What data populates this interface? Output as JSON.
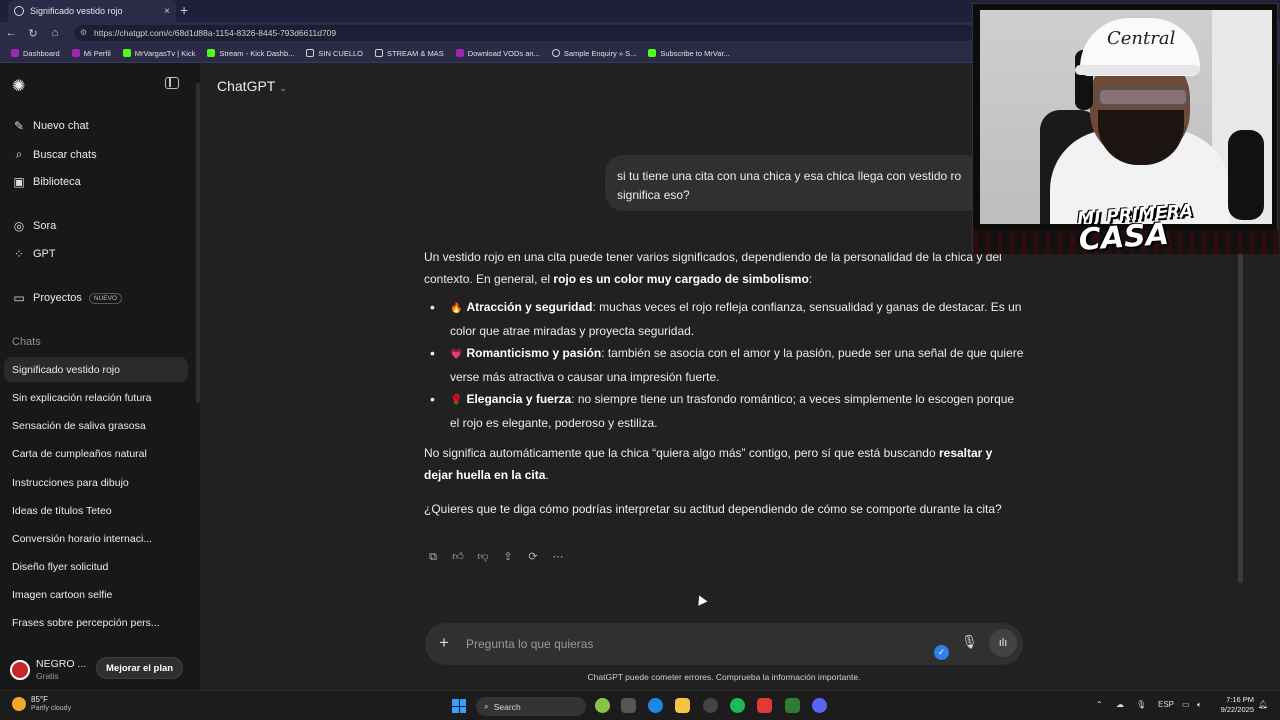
{
  "browser": {
    "tab_title": "Significado vestido rojo",
    "tab_close": "×",
    "new_tab": "+",
    "url": "https://chatgpt.com/c/68d1d88a-1154-8326-8445-793d6611d709",
    "bookmarks": [
      {
        "label": "Dashboard",
        "color": "#9c27b0"
      },
      {
        "label": "Mi Perfil",
        "color": "#9c27b0"
      },
      {
        "label": "MrVargasTv | Kick",
        "color": "#53fc18"
      },
      {
        "label": "Stream - Kick Dashb...",
        "color": "#53fc18"
      },
      {
        "label": "SIN CUELLO",
        "color": "#cfcfcf"
      },
      {
        "label": "STREAM & MAS",
        "color": "#cfcfcf"
      },
      {
        "label": "Download VODs an...",
        "color": "#9c27b0"
      },
      {
        "label": "Sample Enquiry » S...",
        "color": "#cfcfcf"
      },
      {
        "label": "Subscribe to MrVar...",
        "color": "#53fc18"
      }
    ]
  },
  "sidebar": {
    "top_items": [
      {
        "label": "Nuevo chat",
        "icon": "edit-icon"
      },
      {
        "label": "Buscar chats",
        "icon": "search-icon"
      },
      {
        "label": "Biblioteca",
        "icon": "library-icon"
      }
    ],
    "mid_items": [
      {
        "label": "Sora",
        "icon": "sora-icon"
      },
      {
        "label": "GPT",
        "icon": "grid-icon"
      }
    ],
    "projects": {
      "label": "Proyectos",
      "badge": "NUEVO"
    },
    "chats_label": "Chats",
    "chats": [
      "Significado vestido rojo",
      "Sin explicación relación futura",
      "Sensación de saliva grasosa",
      "Carta de cumpleaños natural",
      "Instrucciones para dibujo",
      "Ideas de títulos Teteo",
      "Conversión horario internaci...",
      "Diseño flyer solicitud",
      "Imagen cartoon selfie",
      "Frases sobre percepción pers..."
    ],
    "user": {
      "name": "NEGRO ...",
      "plan": "Gratis",
      "upgrade": "Mejorar el plan"
    }
  },
  "main": {
    "model": "ChatGPT",
    "user_message": "si tu tiene una cita con una chica y esa chica llega con vestido ro significa eso?",
    "answer": {
      "intro_a": "Un vestido rojo en una cita puede tener varios significados, dependiendo de la personalidad de la chica y del contexto. En general, el ",
      "intro_b": "rojo es un color muy cargado de simbolismo",
      "intro_c": ":",
      "bullets": [
        {
          "emoji": "🔥",
          "title": "Atracción y seguridad",
          "text": ": muchas veces el rojo refleja confianza, sensualidad y ganas de destacar. Es un color que atrae miradas y proyecta seguridad."
        },
        {
          "emoji": "💗",
          "title": "Romanticismo y pasión",
          "text": ": también se asocia con el amor y la pasión, puede ser una señal de que quiere verse más atractiva o causar una impresión fuerte."
        },
        {
          "emoji": "🌹",
          "title": "Elegancia y fuerza",
          "text": ": no siempre tiene un trasfondo romántico; a veces simplemente lo escogen porque el rojo es elegante, poderoso y estiliza."
        }
      ],
      "p2_a": "No significa automáticamente que la chica “quiera algo más” contigo, pero sí que está buscando ",
      "p2_b": "resaltar y dejar huella en la cita",
      "p2_c": ".",
      "p3": "¿Quieres que te diga cómo podrías interpretar su actitud dependiendo de cómo se comporte durante la cita?"
    },
    "composer_placeholder": "Pregunta lo que quieras",
    "disclaimer": "ChatGPT puede cometer errores. Comprueba la información importante."
  },
  "webcam": {
    "cap_text": "Central",
    "logo_line1": "MI PRIMERA",
    "logo_line2": "CASA"
  },
  "taskbar": {
    "temp": "85°F",
    "weather": "Partly cloudy",
    "search": "Search",
    "lang": "ESP",
    "time": "7:16 PM",
    "date": "9/22/2025"
  }
}
